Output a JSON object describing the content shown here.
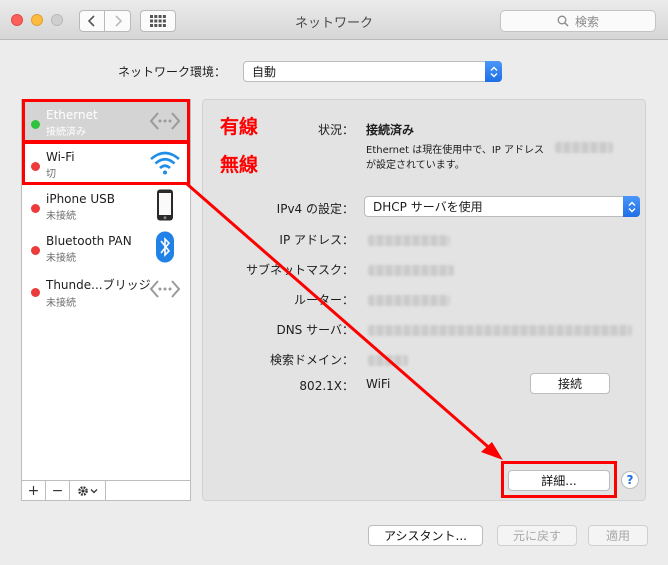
{
  "window": {
    "title": "ネットワーク",
    "search_placeholder": "検索"
  },
  "location": {
    "label": "ネットワーク環境：",
    "value": "自動"
  },
  "services": [
    {
      "name": "Ethernet",
      "status": "接続済み",
      "status_color": "#2fc23d",
      "icon": "ethernet-icon"
    },
    {
      "name": "Wi-Fi",
      "status": "切",
      "status_color": "#ec3b3b",
      "icon": "wifi-icon"
    },
    {
      "name": "iPhone USB",
      "status": "未接続",
      "status_color": "#ec3b3b",
      "icon": "iphone-icon"
    },
    {
      "name": "Bluetooth PAN",
      "status": "未接続",
      "status_color": "#ec3b3b",
      "icon": "bluetooth-icon"
    },
    {
      "name": "Thunde...ブリッジ",
      "status": "未接続",
      "status_color": "#ec3b3b",
      "icon": "thunderbolt-bridge-icon"
    }
  ],
  "sidebar_controls": {
    "add": "+",
    "remove": "−"
  },
  "annotations": {
    "wired": "有線",
    "wireless": "無線"
  },
  "detail": {
    "status_label": "状況：",
    "status_value": "接続済み",
    "status_desc_line1": "Ethernet は現在使用中で、IP アドレス",
    "status_desc_line2": "が設定されています。",
    "ipv4_label": "IPv4 の設定：",
    "ipv4_value": "DHCP サーバを使用",
    "ip_label": "IP アドレス：",
    "subnet_label": "サブネットマスク：",
    "router_label": "ルーター：",
    "dns_label": "DNS サーバ：",
    "search_domain_label": "検索ドメイン：",
    "dot1x_label": "802.1X：",
    "dot1x_value": "WiFi",
    "connect_button": "接続",
    "advanced_button": "詳細...",
    "help": "?"
  },
  "footer": {
    "assistant": "アシスタント...",
    "revert": "元に戻す",
    "apply": "適用"
  },
  "colors": {
    "accent": "#1f6ee6",
    "annotation": "#ff0000"
  }
}
